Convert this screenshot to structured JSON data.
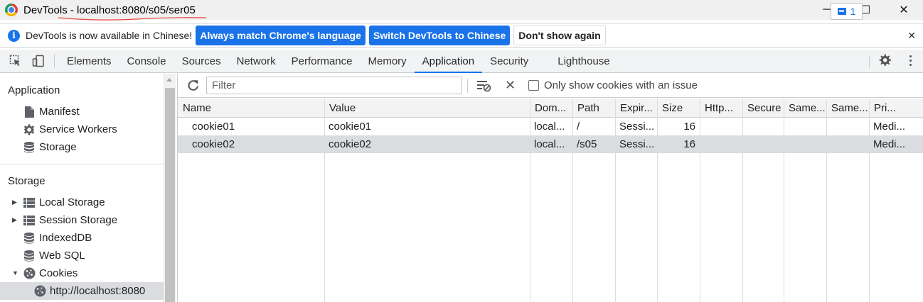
{
  "window": {
    "title": "DevTools - localhost:8080/s05/ser05",
    "min": "─",
    "max": "☐",
    "close": "✕"
  },
  "infobar": {
    "message": "DevTools is now available in Chinese!",
    "btn_match": "Always match Chrome's language",
    "btn_switch": "Switch DevTools to Chinese",
    "btn_dont_show": "Don't show again",
    "close": "✕"
  },
  "tabs": [
    "Elements",
    "Console",
    "Sources",
    "Network",
    "Performance",
    "Memory",
    "Application",
    "Security",
    "Lighthouse"
  ],
  "active_tab": "Application",
  "issues_count": "1",
  "sidebar": {
    "application_heading": "Application",
    "application_items": [
      "Manifest",
      "Service Workers",
      "Storage"
    ],
    "storage_heading": "Storage",
    "storage_items": [
      "Local Storage",
      "Session Storage",
      "IndexedDB",
      "Web SQL",
      "Cookies"
    ],
    "cookie_origin": "http://localhost:8080"
  },
  "toolbar": {
    "filter_placeholder": "Filter",
    "only_issues_label": "Only show cookies with an issue"
  },
  "table": {
    "columns": [
      "Name",
      "Value",
      "Dom...",
      "Path",
      "Expir...",
      "Size",
      "Http...",
      "Secure",
      "Same...",
      "Same...",
      "Pri..."
    ],
    "rows": [
      {
        "name": "cookie01",
        "value": "cookie01",
        "domain": "local...",
        "path": "/",
        "expires": "Sessi...",
        "size": "16",
        "http": "",
        "secure": "",
        "samesite": "",
        "sameparty": "",
        "priority": "Medi..."
      },
      {
        "name": "cookie02",
        "value": "cookie02",
        "domain": "local...",
        "path": "/s05",
        "expires": "Sessi...",
        "size": "16",
        "http": "",
        "secure": "",
        "samesite": "",
        "sameparty": "",
        "priority": "Medi..."
      }
    ],
    "selected_row": 1
  },
  "colors": {
    "accent": "#1a73e8",
    "selected_bg": "#dadce0",
    "annotation_red": "#e8453c"
  }
}
